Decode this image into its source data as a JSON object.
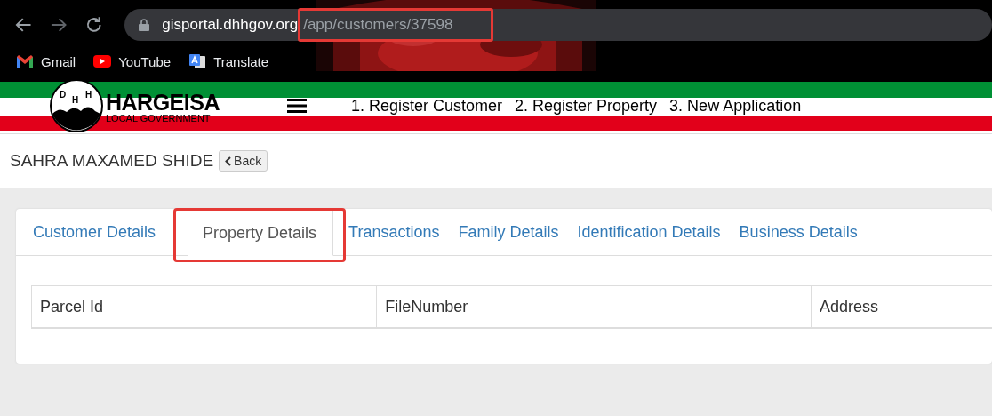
{
  "browser": {
    "url_host": "gisportal.dhhgov.org",
    "url_path": "/app/customers/37598",
    "url_highlighted": true,
    "bookmarks": [
      {
        "label": "Gmail",
        "kind": "gmail"
      },
      {
        "label": "YouTube",
        "kind": "youtube"
      },
      {
        "label": "Translate",
        "kind": "translate"
      }
    ]
  },
  "header": {
    "logo_title": "HARGEISA",
    "logo_subtitle": "LOCAL GOVERNMENT",
    "logo_letters": [
      "D",
      "H",
      "H"
    ],
    "nav": [
      "1. Register Customer",
      "2. Register Property",
      "3. New Application"
    ]
  },
  "customer_name": "SAHRA MAXAMED SHIDE",
  "back_button": "Back",
  "tabs": [
    {
      "label": "Customer Details",
      "selected": false,
      "highlighted": false
    },
    {
      "label": "Property Details",
      "selected": true,
      "highlighted": true
    },
    {
      "label": "Transactions",
      "selected": false,
      "highlighted": false
    },
    {
      "label": "Family Details",
      "selected": false,
      "highlighted": false
    },
    {
      "label": "Identification Details",
      "selected": false,
      "highlighted": false
    },
    {
      "label": "Business Details",
      "selected": false,
      "highlighted": false
    }
  ],
  "table": {
    "columns": [
      "Parcel Id",
      "FileNumber",
      "Address"
    ]
  }
}
